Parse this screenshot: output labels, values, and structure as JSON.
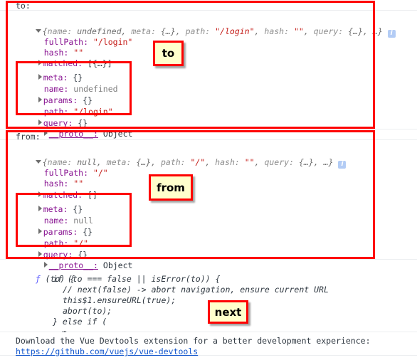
{
  "console": {
    "to_label": "to:",
    "from_label": "from:",
    "to_object": {
      "header": {
        "open_brace": "{",
        "k1": "name:",
        "v1": "undefined",
        "k2": "meta:",
        "v2": "{…}",
        "k3": "path:",
        "v3": "\"/login\"",
        "k4": "hash:",
        "v4": "\"\"",
        "k5": "query:",
        "v5": "{…}",
        "ellipsis": "…}",
        "info": "i"
      },
      "rows": [
        {
          "key": "fullPath:",
          "value": "\"/login\"",
          "type": "string",
          "expandable": false
        },
        {
          "key": "hash:",
          "value": "\"\"",
          "type": "string",
          "expandable": false
        },
        {
          "key": "matched:",
          "value": "[{…}]",
          "type": "punc",
          "expandable": true
        },
        {
          "key": "meta:",
          "value": "{}",
          "type": "punc",
          "expandable": true
        },
        {
          "key": "name:",
          "value": "undefined",
          "type": "undefined",
          "expandable": false
        },
        {
          "key": "params:",
          "value": "{}",
          "type": "punc",
          "expandable": true
        },
        {
          "key": "path:",
          "value": "\"/login\"",
          "type": "string",
          "expandable": false
        },
        {
          "key": "query:",
          "value": "{}",
          "type": "punc",
          "expandable": true
        },
        {
          "key": "__proto__:",
          "value": "Object",
          "type": "punc",
          "expandable": true
        }
      ]
    },
    "from_object": {
      "header": {
        "open_brace": "{",
        "k1": "name:",
        "v1": "null",
        "k2": "meta:",
        "v2": "{…}",
        "k3": "path:",
        "v3": "\"/\"",
        "k4": "hash:",
        "v4": "\"\"",
        "k5": "query:",
        "v5": "{…}",
        "ellipsis": "…}",
        "info": "i"
      },
      "rows": [
        {
          "key": "fullPath:",
          "value": "\"/\"",
          "type": "string",
          "expandable": false
        },
        {
          "key": "hash:",
          "value": "\"\"",
          "type": "string",
          "expandable": false
        },
        {
          "key": "matched:",
          "value": "[]",
          "type": "punc",
          "expandable": true
        },
        {
          "key": "meta:",
          "value": "{}",
          "type": "punc",
          "expandable": true
        },
        {
          "key": "name:",
          "value": "null",
          "type": "null",
          "expandable": false
        },
        {
          "key": "params:",
          "value": "{}",
          "type": "punc",
          "expandable": true
        },
        {
          "key": "path:",
          "value": "\"/\"",
          "type": "string",
          "expandable": false
        },
        {
          "key": "query:",
          "value": "{}",
          "type": "punc",
          "expandable": true
        },
        {
          "key": "__proto__:",
          "value": "Object",
          "type": "punc",
          "expandable": true
        }
      ]
    },
    "function_block": {
      "l0_f": "ƒ",
      "l0_rest": " (to) {",
      "l1": "if (to === false || isError(to)) {",
      "l2": "// next(false) -> abort navigation, ensure current URL",
      "l3": "this$1.ensureURL(true);",
      "l4": "abort(to);",
      "l5": "} else if (",
      "l6": "…"
    },
    "devtools_message": {
      "text": "Download the Vue Devtools extension for a better development experience:",
      "link": "https://github.com/vuejs/vue-devtools"
    }
  },
  "annotations": {
    "callouts": [
      {
        "label": "to"
      },
      {
        "label": "from"
      },
      {
        "label": "next"
      }
    ],
    "highlight_color": "#fe0000",
    "callout_bg": "#ffffcc"
  }
}
